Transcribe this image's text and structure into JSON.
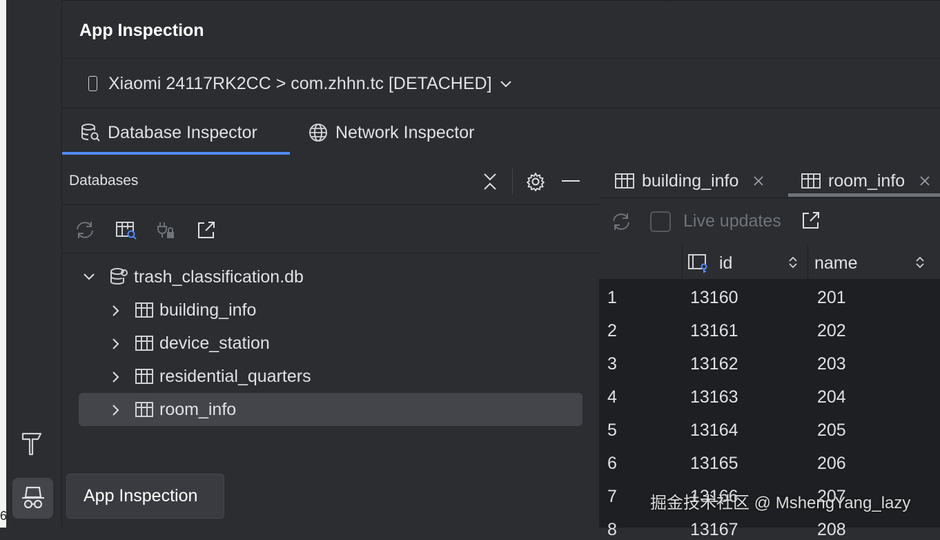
{
  "panel_title": "App Inspection",
  "device_selector": {
    "label": "Xiaomi 24117RK2CC > com.zhhn.tc [DETACHED]"
  },
  "tabs": [
    {
      "label": "Database Inspector",
      "active": true,
      "icon": "database-search-icon"
    },
    {
      "label": "Network Inspector",
      "active": false,
      "icon": "globe-icon"
    }
  ],
  "databases_panel": {
    "header": "Databases",
    "tree": {
      "db_name": "trash_classification.db",
      "tables": [
        "building_info",
        "device_station",
        "residential_quarters",
        "room_info"
      ],
      "selected_table": "room_info"
    }
  },
  "table_tabs": [
    {
      "label": "building_info"
    },
    {
      "label": "room_info",
      "active": true
    }
  ],
  "table_toolbar": {
    "live_updates_label": "Live updates"
  },
  "grid": {
    "columns": [
      "id",
      "name"
    ],
    "rows": [
      [
        "1",
        "13160",
        "201"
      ],
      [
        "2",
        "13161",
        "202"
      ],
      [
        "3",
        "13162",
        "203"
      ],
      [
        "4",
        "13163",
        "204"
      ],
      [
        "5",
        "13164",
        "205"
      ],
      [
        "6",
        "13165",
        "206"
      ],
      [
        "7",
        "13166",
        "207"
      ],
      [
        "8",
        "13167",
        "208"
      ]
    ]
  },
  "tooltip": "App Inspection",
  "watermark": "掘金技术社区 @ MshengYang_lazy",
  "colors": {
    "accent": "#548af7",
    "background": "#2b2d30",
    "selected_row": "#43454a"
  }
}
